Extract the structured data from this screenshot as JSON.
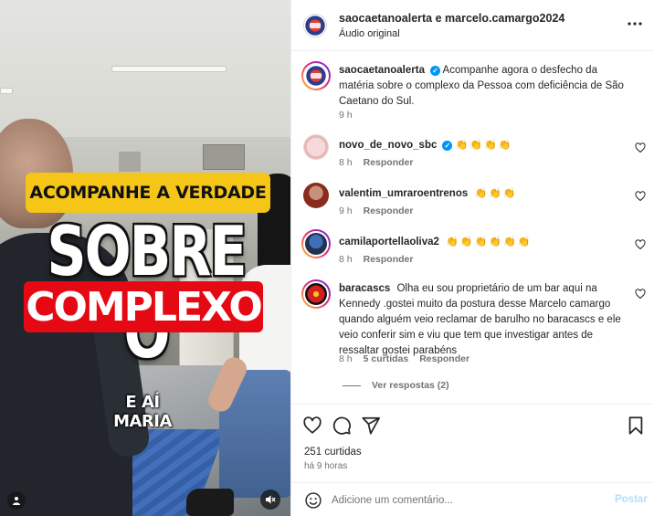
{
  "video": {
    "headline_top": "ACOMPANHE A VERDADE",
    "headline_big": "SOBRE O",
    "headline_red": "COMPLEXO",
    "caption": "E AÍ MARIA",
    "colors": {
      "yellow": "#f5c518",
      "red": "#e50914"
    },
    "icons": [
      "user-tag-icon",
      "audio-muted-icon"
    ]
  },
  "header": {
    "users": "saocaetanoalerta e marcelo.camargo2024",
    "audio": "Áudio original",
    "more_icon": "more-options-icon"
  },
  "caption_post": {
    "user": "saocaetanoalerta",
    "verified": true,
    "text": "Acompanhe agora o desfecho da matéria sobre o complexo da Pessoa com deficiência de São Caetano do Sul.",
    "time": "9 h"
  },
  "comments": [
    {
      "user": "novo_de_novo_sbc",
      "verified": true,
      "text": "👏👏👏👏",
      "time": "8 h",
      "likes": "",
      "reply": "Responder"
    },
    {
      "user": "valentim_umraroentrenos",
      "verified": false,
      "text": "👏👏👏",
      "time": "9 h",
      "likes": "",
      "reply": "Responder"
    },
    {
      "user": "camilaportellaoliva2",
      "verified": false,
      "text": "👏👏👏👏👏👏",
      "time": "8 h",
      "likes": "",
      "reply": "Responder"
    },
    {
      "user": "baracascs",
      "verified": false,
      "text": "Olha eu sou proprietário de um bar aqui na Kennedy .gostei muito da postura desse Marcelo camargo quando alguém veio reclamar de barulho no baracascs e ele veio conferir sim e viu que tem que investigar antes de ressaltar gostei parabéns",
      "time": "8 h",
      "likes": "5 curtidas",
      "reply": "Responder"
    }
  ],
  "view_replies": "Ver respostas (2)",
  "actions": {
    "icons": [
      "heart-icon",
      "comment-icon",
      "share-icon",
      "bookmark-icon"
    ],
    "likes": "251 curtidas",
    "time": "há 9 horas"
  },
  "add_comment": {
    "placeholder": "Adicione um comentário...",
    "post_label": "Postar",
    "emoji_icon": "emoji-icon"
  },
  "colors": {
    "verified": "#0095f6",
    "muted_text": "#737373",
    "post_disabled": "#b2dffc"
  }
}
